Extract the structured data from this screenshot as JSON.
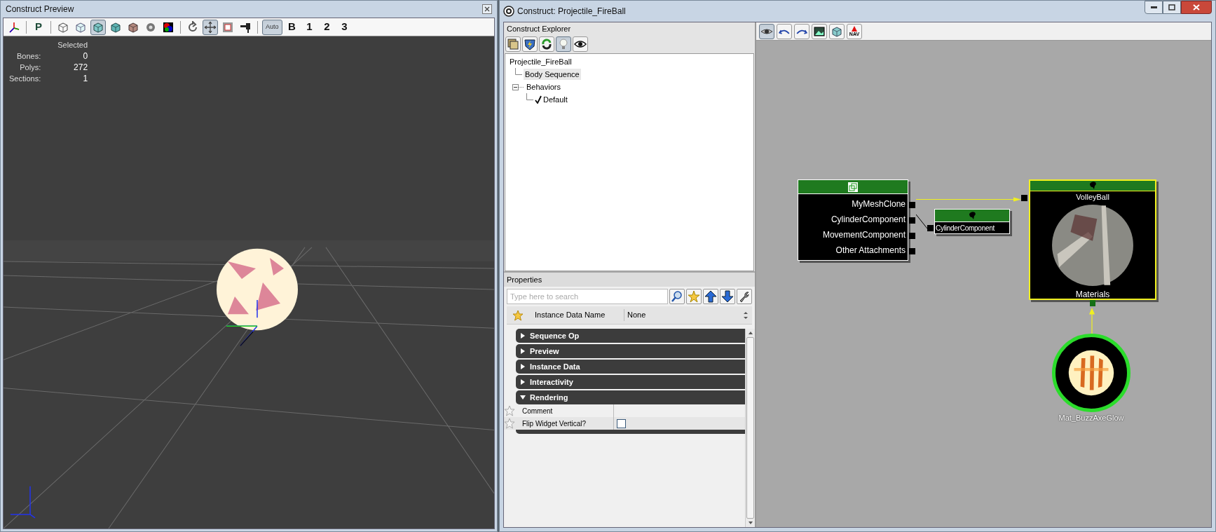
{
  "preview_window": {
    "title": "Construct Preview",
    "toolbar": [
      {
        "kind": "icon",
        "pressed": false
      },
      {
        "kind": "separator"
      },
      {
        "kind": "text",
        "label": "P",
        "pressed": false
      },
      {
        "kind": "separator"
      },
      {
        "kind": "icon",
        "pressed": false
      },
      {
        "kind": "icon",
        "pressed": false
      },
      {
        "kind": "icon",
        "pressed": true
      },
      {
        "kind": "icon",
        "pressed": false
      },
      {
        "kind": "icon",
        "pressed": false
      },
      {
        "kind": "icon",
        "pressed": false
      },
      {
        "kind": "icon",
        "pressed": false
      },
      {
        "kind": "separator"
      },
      {
        "kind": "icon",
        "pressed": false
      },
      {
        "kind": "icon",
        "pressed": true
      },
      {
        "kind": "icon",
        "pressed": false
      },
      {
        "kind": "icon",
        "pressed": false
      },
      {
        "kind": "separator"
      },
      {
        "kind": "text",
        "label": "Auto",
        "pressed": true
      },
      {
        "kind": "text",
        "label": "B",
        "pressed": false
      },
      {
        "kind": "text",
        "label": "1",
        "pressed": false
      },
      {
        "kind": "text",
        "label": "2",
        "pressed": false
      },
      {
        "kind": "text",
        "label": "3",
        "pressed": false
      }
    ],
    "stats": {
      "header": "Selected",
      "rows": [
        {
          "label": "Bones:",
          "value": "0"
        },
        {
          "label": "Polys:",
          "value": "272"
        },
        {
          "label": "Sections:",
          "value": "1"
        }
      ]
    }
  },
  "construct_window": {
    "title": "Construct: Projectile_FireBall",
    "explorer": {
      "title": "Construct Explorer",
      "tools": [
        {
          "pressed": false
        },
        {
          "pressed": false
        },
        {
          "pressed": false
        },
        {
          "pressed": true
        },
        {
          "pressed": false
        }
      ],
      "tree": [
        {
          "label": "Projectile_FireBall",
          "selected": false,
          "children": [
            {
              "label": "Body Sequence",
              "selected": true
            },
            {
              "label": "Behaviors",
              "selected": false,
              "expanded": true,
              "children": [
                {
                  "label": "Default",
                  "selected": false,
                  "checked": true
                }
              ]
            }
          ]
        }
      ]
    },
    "graph_toolbar": [
      {
        "pressed": true
      },
      {
        "pressed": false
      },
      {
        "pressed": false
      },
      {
        "pressed": false
      },
      {
        "pressed": false
      },
      {
        "pressed": false,
        "label": "NAV"
      }
    ],
    "properties": {
      "title": "Properties",
      "search": {
        "placeholder": "Type here to search"
      },
      "instance_row": {
        "label": "Instance Data Name",
        "value": "None",
        "favorite": true
      },
      "categories": [
        {
          "name": "Sequence Op",
          "expanded": false
        },
        {
          "name": "Preview",
          "expanded": false
        },
        {
          "name": "Instance Data",
          "expanded": false
        },
        {
          "name": "Interactivity",
          "expanded": false
        },
        {
          "name": "Rendering",
          "expanded": true,
          "properties": [
            {
              "kind": "text",
              "label": "Comment",
              "favorite": false
            },
            {
              "kind": "checkbox",
              "label": "Flip Widget Vertical?",
              "checked": false,
              "favorite": false
            }
          ]
        }
      ]
    },
    "graph": {
      "nodes": [
        {
          "kind": "group",
          "selected": false,
          "outputs": [
            "MyMeshClone",
            "CylinderComponent",
            "MovementComponent",
            "Other Attachments"
          ]
        },
        {
          "kind": "component",
          "selected": false,
          "label": "CylinderComponent"
        },
        {
          "kind": "mesh",
          "selected": true,
          "label": "VolleyBall",
          "footer": "Materials"
        },
        {
          "kind": "material",
          "selected": false,
          "label": "Mat_BuzzAxeGlow"
        }
      ]
    }
  }
}
